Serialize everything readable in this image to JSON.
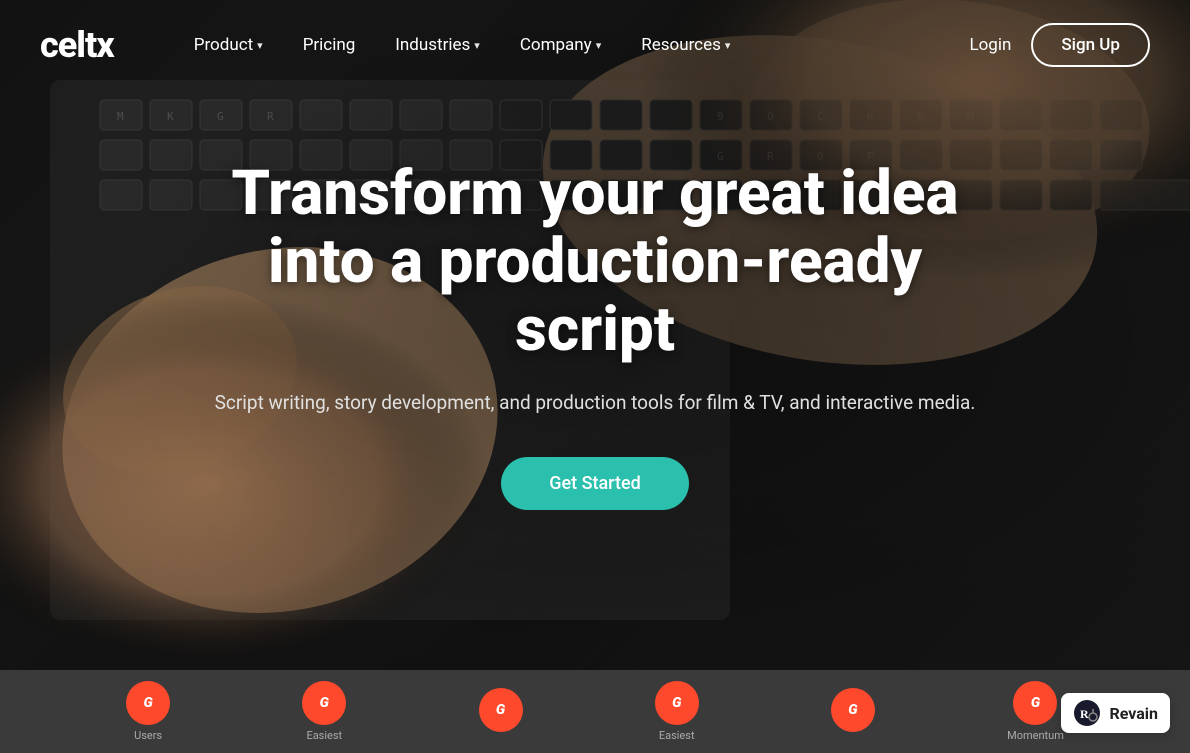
{
  "brand": {
    "name": "celtx",
    "color": "#ffffff"
  },
  "navbar": {
    "logo_label": "celtx",
    "items": [
      {
        "label": "Product",
        "has_dropdown": true,
        "id": "product"
      },
      {
        "label": "Pricing",
        "has_dropdown": false,
        "id": "pricing"
      },
      {
        "label": "Industries",
        "has_dropdown": true,
        "id": "industries"
      },
      {
        "label": "Company",
        "has_dropdown": true,
        "id": "company"
      },
      {
        "label": "Resources",
        "has_dropdown": true,
        "id": "resources"
      }
    ],
    "login_label": "Login",
    "signup_label": "Sign Up"
  },
  "hero": {
    "title": "Transform your great idea into a production-ready script",
    "subtitle": "Script writing, story development, and production tools for film & TV, and interactive media.",
    "cta_label": "Get Started",
    "cta_color": "#2bbfad"
  },
  "awards": {
    "items": [
      {
        "label": "Users",
        "icon": "G"
      },
      {
        "label": "Easiest",
        "icon": "G"
      },
      {
        "label": "",
        "icon": "G"
      },
      {
        "label": "Easiest",
        "icon": "G"
      },
      {
        "label": "",
        "icon": "G"
      },
      {
        "label": "Momentum",
        "icon": "G"
      }
    ]
  },
  "revain": {
    "label": "Revain"
  }
}
